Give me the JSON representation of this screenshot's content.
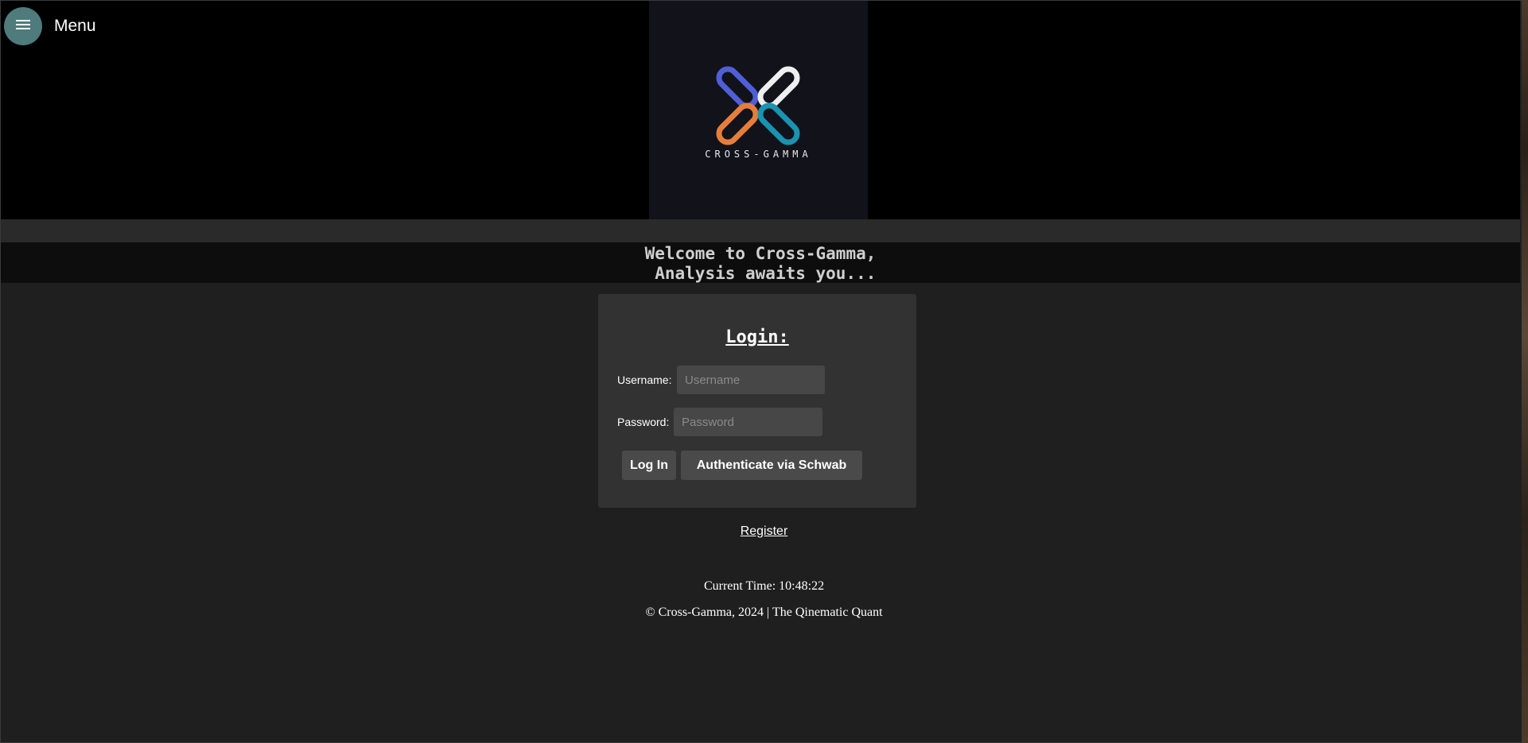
{
  "header": {
    "menu_label": "Menu",
    "menu_icon": "hamburger-icon",
    "logo_text": "CROSS-GAMMA",
    "logo_colors": [
      "#4f5fd6",
      "#efefef",
      "#e57e3a",
      "#1993b0"
    ]
  },
  "welcome": {
    "text": "Welcome to Cross-Gamma,\n Analysis awaits you..."
  },
  "login": {
    "title": "Login:",
    "username_label": "Username:",
    "username_placeholder": "Username",
    "password_label": "Password:",
    "password_placeholder": "Password",
    "login_button": "Log In",
    "schwab_button": "Authenticate via Schwab"
  },
  "register_link": "Register",
  "footer": {
    "time_label": "Current Time:",
    "time_value": "10:48:22",
    "copyright": "© Cross-Gamma, 2024 | The Qinematic Quant"
  },
  "colors": {
    "menu_button": "#4f7b7d",
    "header_bg": "#000000",
    "page_bg": "#1f1f1f",
    "card_bg": "#323232"
  }
}
